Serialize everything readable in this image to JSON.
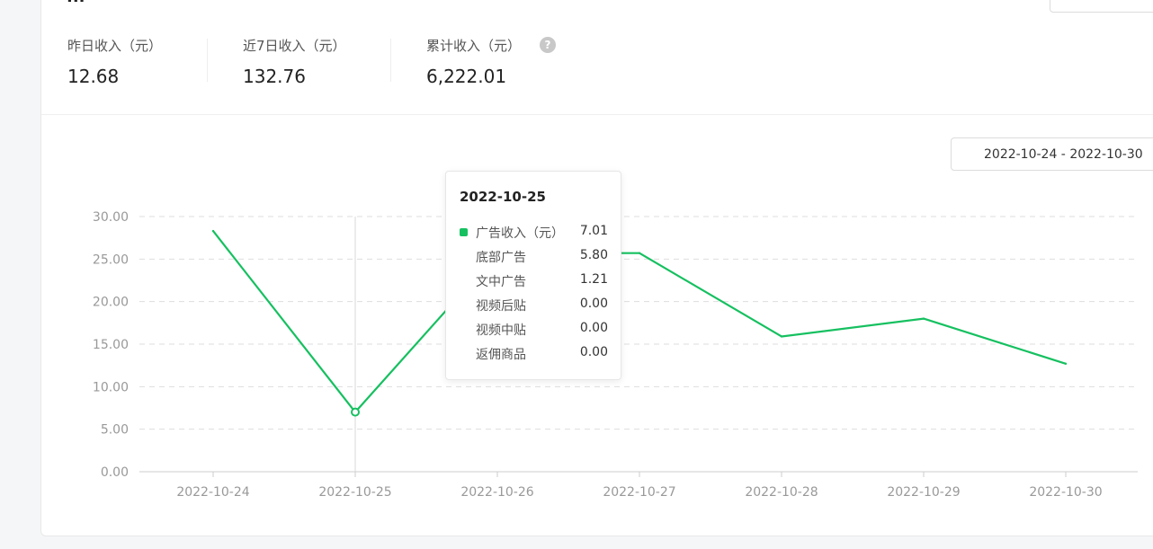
{
  "header": {
    "section_title": "...",
    "top_right_button": ""
  },
  "stats": [
    {
      "label": "昨日收入（元）",
      "value": "12.68"
    },
    {
      "label": "近7日收入（元）",
      "value": "132.76"
    },
    {
      "label": "累计收入（元）",
      "value": "6,222.01"
    }
  ],
  "help_icon": {
    "name": "question-circle-icon",
    "glyph": "?"
  },
  "date_range": "2022-10-24 - 2022-10-30",
  "colors": {
    "line": "#16c060",
    "grid": "#dddddd",
    "axis": "#999999"
  },
  "chart_data": {
    "type": "line",
    "categories": [
      "2022-10-24",
      "2022-10-25",
      "2022-10-26",
      "2022-10-27",
      "2022-10-28",
      "2022-10-29",
      "2022-10-30"
    ],
    "series": [
      {
        "name": "广告收入（元）",
        "values": [
          28.3,
          7.01,
          25.7,
          25.7,
          15.9,
          18.0,
          12.7
        ]
      }
    ],
    "y_ticks": [
      "0.00",
      "5.00",
      "10.00",
      "15.00",
      "20.00",
      "25.00",
      "30.00"
    ],
    "ylim": [
      0,
      30
    ],
    "grid": true,
    "highlight_index": 1
  },
  "tooltip": {
    "title": "2022-10-25",
    "rows": [
      {
        "name": "广告收入（元）",
        "value": "7.01"
      },
      {
        "name": "底部广告",
        "value": "5.80"
      },
      {
        "name": "文中广告",
        "value": "1.21"
      },
      {
        "name": "视频后贴",
        "value": "0.00"
      },
      {
        "name": "视频中贴",
        "value": "0.00"
      },
      {
        "name": "返佣商品",
        "value": "0.00"
      }
    ]
  }
}
